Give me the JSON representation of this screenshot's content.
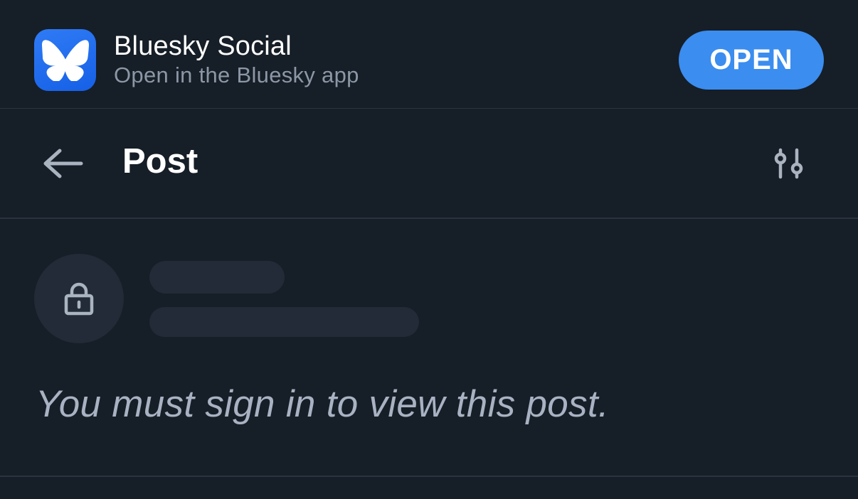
{
  "banner": {
    "app_name": "Bluesky Social",
    "app_subtitle": "Open in the Bluesky app",
    "open_label": "OPEN",
    "icon": "butterfly-icon",
    "accent_color": "#3b8def",
    "icon_color": "#1f6ef0"
  },
  "header": {
    "title": "Post",
    "back_icon": "arrow-left-icon",
    "filter_icon": "sliders-icon"
  },
  "post": {
    "avatar_icon": "lock-icon",
    "message": "You must sign in to view this post."
  },
  "theme": {
    "background": "#161e27",
    "divider": "#2a3340",
    "placeholder": "#232b38"
  }
}
